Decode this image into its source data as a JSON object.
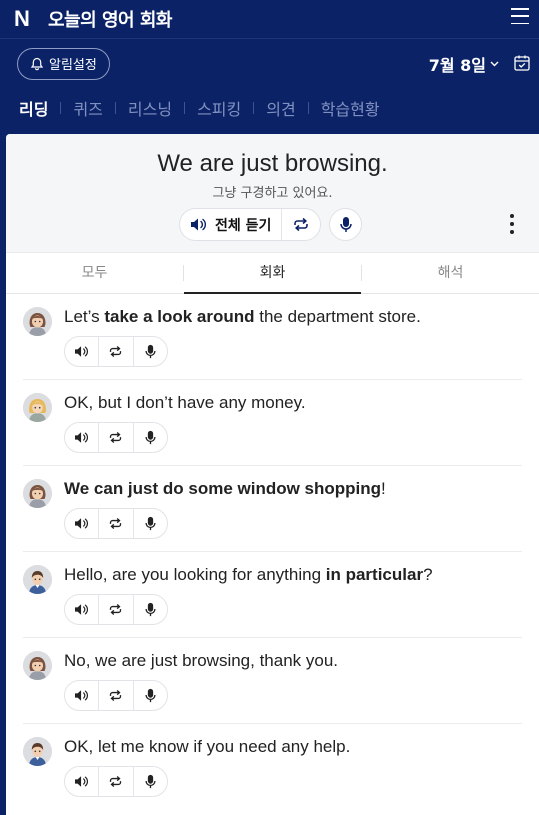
{
  "app": {
    "logo": "N",
    "title": "오늘의 영어 회화"
  },
  "subbar": {
    "alarm_label": "알림설정",
    "date_label": "7월 8일"
  },
  "tabs": [
    {
      "label": "리딩",
      "active": true
    },
    {
      "label": "퀴즈"
    },
    {
      "label": "리스닝"
    },
    {
      "label": "스피킹"
    },
    {
      "label": "의견"
    },
    {
      "label": "학습현황"
    }
  ],
  "lesson": {
    "sentence": "We are just browsing.",
    "translation": "그냥 구경하고 있어요.",
    "listen_all_label": "전체 듣기"
  },
  "view_tabs": [
    {
      "label": "모두"
    },
    {
      "label": "회화",
      "active": true
    },
    {
      "label": "해석"
    }
  ],
  "dialog": [
    {
      "speaker": "woman",
      "parts": [
        {
          "t": "Let’s "
        },
        {
          "t": "take a look around",
          "b": true
        },
        {
          "t": " the department store."
        }
      ]
    },
    {
      "speaker": "blonde-woman",
      "parts": [
        {
          "t": "OK, but I don’t have any money."
        }
      ]
    },
    {
      "speaker": "woman",
      "parts": [
        {
          "t": "We can just do some window shopping",
          "b": true
        },
        {
          "t": "!"
        }
      ]
    },
    {
      "speaker": "man",
      "parts": [
        {
          "t": "Hello, are you looking for anything "
        },
        {
          "t": "in particular",
          "b": true
        },
        {
          "t": "?"
        }
      ]
    },
    {
      "speaker": "woman",
      "parts": [
        {
          "t": "No, we are just browsing, thank you."
        }
      ]
    },
    {
      "speaker": "man",
      "parts": [
        {
          "t": "OK, let me know if you need any help."
        }
      ]
    }
  ],
  "colors": {
    "header_bg": "#0b2366",
    "accent": "#0b2366",
    "text": "#222222"
  }
}
